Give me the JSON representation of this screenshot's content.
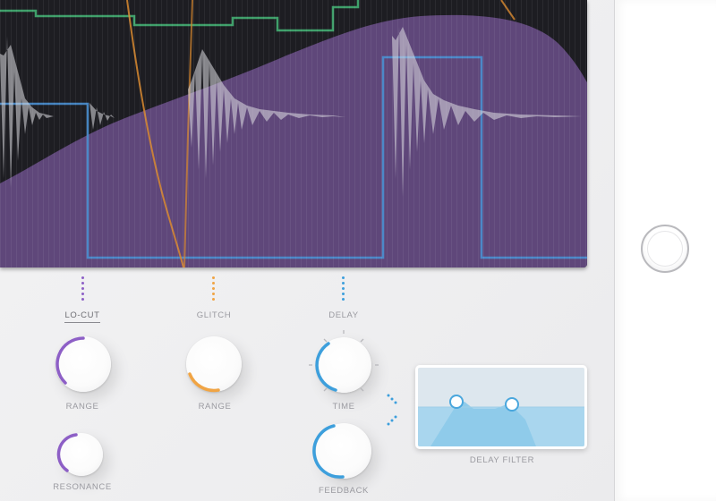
{
  "labels": {
    "lo_cut": "LO-CUT",
    "glitch": "GLITCH",
    "delay": "DELAY",
    "range_1": "RANGE",
    "range_2": "RANGE",
    "time": "TIME",
    "resonance": "RESONANCE",
    "feedback": "FEEDBACK",
    "delay_filter": "DELAY FILTER"
  },
  "colors": {
    "lo_cut": "#8d5fc6",
    "glitch": "#f0a444",
    "delay": "#3d9fdc",
    "visualizer_bg": "#1d1d22",
    "envelope_fill": "#6b4f8a",
    "square_wave": "#4a8fd0",
    "green_line": "#3f9f6a",
    "orange_line": "#d9892f",
    "filter_fill": "#8fcbea",
    "filter_bg": "#dde7ee"
  },
  "knobs": {
    "range_1": {
      "value": 0.55,
      "color": "lo_cut"
    },
    "range_2": {
      "value": 0.35,
      "color": "glitch"
    },
    "time": {
      "value": 0.55,
      "color": "delay"
    },
    "resonance": {
      "value": 0.45,
      "color": "lo_cut"
    },
    "feedback": {
      "value": 0.5,
      "color": "delay"
    }
  }
}
